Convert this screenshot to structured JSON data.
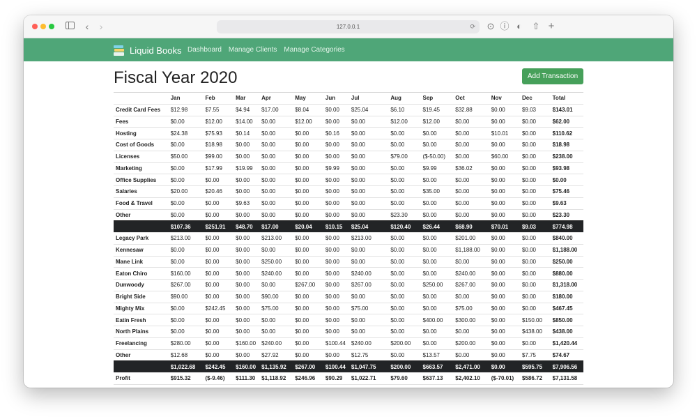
{
  "browser": {
    "url": "127.0.0.1"
  },
  "nav": {
    "brand": "Liquid Books",
    "links": [
      "Dashboard",
      "Manage Clients",
      "Manage Categories"
    ]
  },
  "page": {
    "title": "Fiscal Year 2020",
    "add_button": "Add Transaction"
  },
  "table": {
    "headers": [
      "",
      "Jan",
      "Feb",
      "Mar",
      "Apr",
      "May",
      "Jun",
      "Jul",
      "Aug",
      "Sep",
      "Oct",
      "Nov",
      "Dec",
      "Total"
    ],
    "expense_rows": [
      {
        "label": "Credit Card Fees",
        "values": [
          "$12.98",
          "$7.55",
          "$4.94",
          "$17.00",
          "$8.04",
          "$0.00",
          "$25.04",
          "$6.10",
          "$19.45",
          "$32.88",
          "$0.00",
          "$9.03"
        ],
        "total": "$143.01"
      },
      {
        "label": "Fees",
        "values": [
          "$0.00",
          "$12.00",
          "$14.00",
          "$0.00",
          "$12.00",
          "$0.00",
          "$0.00",
          "$12.00",
          "$12.00",
          "$0.00",
          "$0.00",
          "$0.00"
        ],
        "total": "$62.00"
      },
      {
        "label": "Hosting",
        "values": [
          "$24.38",
          "$75.93",
          "$0.14",
          "$0.00",
          "$0.00",
          "$0.16",
          "$0.00",
          "$0.00",
          "$0.00",
          "$0.00",
          "$10.01",
          "$0.00"
        ],
        "total": "$110.62"
      },
      {
        "label": "Cost of Goods",
        "values": [
          "$0.00",
          "$18.98",
          "$0.00",
          "$0.00",
          "$0.00",
          "$0.00",
          "$0.00",
          "$0.00",
          "$0.00",
          "$0.00",
          "$0.00",
          "$0.00"
        ],
        "total": "$18.98"
      },
      {
        "label": "Licenses",
        "values": [
          "$50.00",
          "$99.00",
          "$0.00",
          "$0.00",
          "$0.00",
          "$0.00",
          "$0.00",
          "$79.00",
          "($-50.00)",
          "$0.00",
          "$60.00",
          "$0.00"
        ],
        "total": "$238.00"
      },
      {
        "label": "Marketing",
        "values": [
          "$0.00",
          "$17.99",
          "$19.99",
          "$0.00",
          "$0.00",
          "$9.99",
          "$0.00",
          "$0.00",
          "$9.99",
          "$36.02",
          "$0.00",
          "$0.00"
        ],
        "total": "$93.98"
      },
      {
        "label": "Office Supplies",
        "values": [
          "$0.00",
          "$0.00",
          "$0.00",
          "$0.00",
          "$0.00",
          "$0.00",
          "$0.00",
          "$0.00",
          "$0.00",
          "$0.00",
          "$0.00",
          "$0.00"
        ],
        "total": "$0.00"
      },
      {
        "label": "Salaries",
        "values": [
          "$20.00",
          "$20.46",
          "$0.00",
          "$0.00",
          "$0.00",
          "$0.00",
          "$0.00",
          "$0.00",
          "$35.00",
          "$0.00",
          "$0.00",
          "$0.00"
        ],
        "total": "$75.46"
      },
      {
        "label": "Food & Travel",
        "values": [
          "$0.00",
          "$0.00",
          "$9.63",
          "$0.00",
          "$0.00",
          "$0.00",
          "$0.00",
          "$0.00",
          "$0.00",
          "$0.00",
          "$0.00",
          "$0.00"
        ],
        "total": "$9.63"
      },
      {
        "label": "Other",
        "values": [
          "$0.00",
          "$0.00",
          "$0.00",
          "$0.00",
          "$0.00",
          "$0.00",
          "$0.00",
          "$23.30",
          "$0.00",
          "$0.00",
          "$0.00",
          "$0.00"
        ],
        "total": "$23.30"
      }
    ],
    "expense_totals": {
      "values": [
        "$107.36",
        "$251.91",
        "$48.70",
        "$17.00",
        "$20.04",
        "$10.15",
        "$25.04",
        "$120.40",
        "$26.44",
        "$68.90",
        "$70.01",
        "$9.03"
      ],
      "total": "$774.98"
    },
    "income_rows": [
      {
        "label": "Legacy Park",
        "values": [
          "$213.00",
          "$0.00",
          "$0.00",
          "$213.00",
          "$0.00",
          "$0.00",
          "$213.00",
          "$0.00",
          "$0.00",
          "$201.00",
          "$0.00",
          "$0.00"
        ],
        "total": "$840.00"
      },
      {
        "label": "Kennesaw",
        "values": [
          "$0.00",
          "$0.00",
          "$0.00",
          "$0.00",
          "$0.00",
          "$0.00",
          "$0.00",
          "$0.00",
          "$0.00",
          "$1,188.00",
          "$0.00",
          "$0.00"
        ],
        "total": "$1,188.00"
      },
      {
        "label": "Mane Link",
        "values": [
          "$0.00",
          "$0.00",
          "$0.00",
          "$250.00",
          "$0.00",
          "$0.00",
          "$0.00",
          "$0.00",
          "$0.00",
          "$0.00",
          "$0.00",
          "$0.00"
        ],
        "total": "$250.00"
      },
      {
        "label": "Eaton Chiro",
        "values": [
          "$160.00",
          "$0.00",
          "$0.00",
          "$240.00",
          "$0.00",
          "$0.00",
          "$240.00",
          "$0.00",
          "$0.00",
          "$240.00",
          "$0.00",
          "$0.00"
        ],
        "total": "$880.00"
      },
      {
        "label": "Dunwoody",
        "values": [
          "$267.00",
          "$0.00",
          "$0.00",
          "$0.00",
          "$267.00",
          "$0.00",
          "$267.00",
          "$0.00",
          "$250.00",
          "$267.00",
          "$0.00",
          "$0.00"
        ],
        "total": "$1,318.00"
      },
      {
        "label": "Bright Side",
        "values": [
          "$90.00",
          "$0.00",
          "$0.00",
          "$90.00",
          "$0.00",
          "$0.00",
          "$0.00",
          "$0.00",
          "$0.00",
          "$0.00",
          "$0.00",
          "$0.00"
        ],
        "total": "$180.00"
      },
      {
        "label": "Mighty Mix",
        "values": [
          "$0.00",
          "$242.45",
          "$0.00",
          "$75.00",
          "$0.00",
          "$0.00",
          "$75.00",
          "$0.00",
          "$0.00",
          "$75.00",
          "$0.00",
          "$0.00"
        ],
        "total": "$467.45"
      },
      {
        "label": "Eatin Fresh",
        "values": [
          "$0.00",
          "$0.00",
          "$0.00",
          "$0.00",
          "$0.00",
          "$0.00",
          "$0.00",
          "$0.00",
          "$400.00",
          "$300.00",
          "$0.00",
          "$150.00"
        ],
        "total": "$850.00"
      },
      {
        "label": "North Plains",
        "values": [
          "$0.00",
          "$0.00",
          "$0.00",
          "$0.00",
          "$0.00",
          "$0.00",
          "$0.00",
          "$0.00",
          "$0.00",
          "$0.00",
          "$0.00",
          "$438.00"
        ],
        "total": "$438.00"
      },
      {
        "label": "Freelancing",
        "values": [
          "$280.00",
          "$0.00",
          "$160.00",
          "$240.00",
          "$0.00",
          "$100.44",
          "$240.00",
          "$200.00",
          "$0.00",
          "$200.00",
          "$0.00",
          "$0.00"
        ],
        "total": "$1,420.44"
      },
      {
        "label": "Other",
        "values": [
          "$12.68",
          "$0.00",
          "$0.00",
          "$27.92",
          "$0.00",
          "$0.00",
          "$12.75",
          "$0.00",
          "$13.57",
          "$0.00",
          "$0.00",
          "$7.75"
        ],
        "total": "$74.67"
      }
    ],
    "income_totals": {
      "values": [
        "$1,022.68",
        "$242.45",
        "$160.00",
        "$1,135.92",
        "$267.00",
        "$100.44",
        "$1,047.75",
        "$200.00",
        "$663.57",
        "$2,471.00",
        "$0.00",
        "$595.75"
      ],
      "total": "$7,906.56"
    },
    "profit": {
      "label": "Profit",
      "values": [
        "$915.32",
        "($-9.46)",
        "$111.30",
        "$1,118.92",
        "$246.96",
        "$90.29",
        "$1,022.71",
        "$79.60",
        "$637.13",
        "$2,402.10",
        "($-70.01)",
        "$586.72"
      ],
      "total": "$7,131.58"
    }
  }
}
